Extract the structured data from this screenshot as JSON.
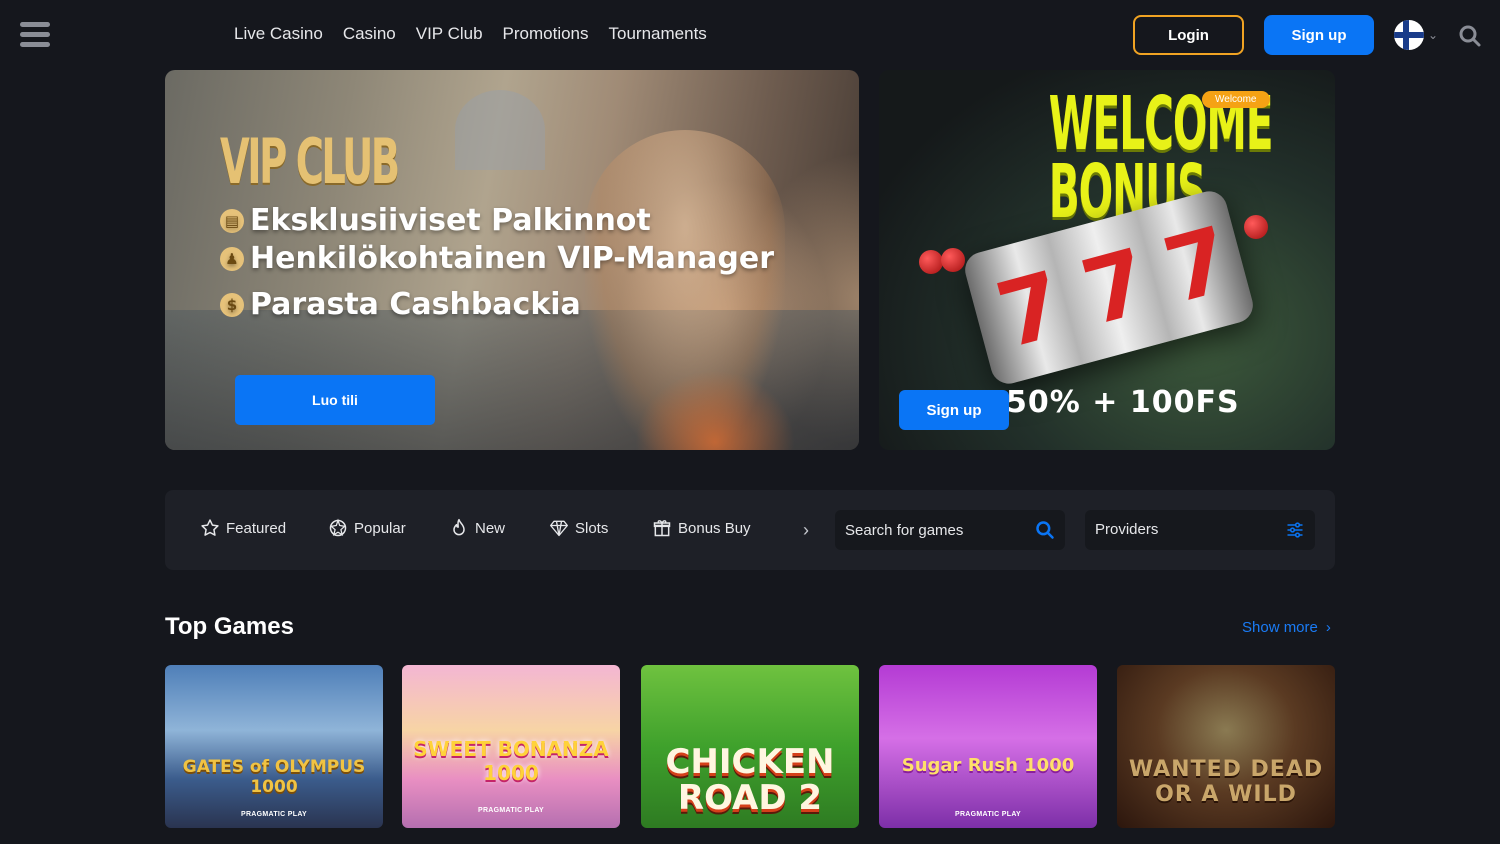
{
  "header": {
    "nav": [
      "Live Casino",
      "Casino",
      "VIP Club",
      "Promotions",
      "Tournaments"
    ],
    "login_label": "Login",
    "signup_label": "Sign up",
    "language": "fi"
  },
  "banners": {
    "vip": {
      "title": "VIP CLUB",
      "lines": [
        "Eksklusiiviset Palkinnot",
        "Henkilökohtainen VIP-Manager",
        "Parasta Cashbackia"
      ],
      "button_label": "Luo tili"
    },
    "welcome": {
      "title_line1": "WELCOME",
      "title_line2": "BONUS",
      "badge": "Welcome",
      "offer": "50% + 100FS",
      "button_label": "Sign up"
    }
  },
  "filters": {
    "categories": [
      {
        "label": "Featured",
        "icon": "star-icon"
      },
      {
        "label": "Popular",
        "icon": "popular-icon"
      },
      {
        "label": "New",
        "icon": "flame-icon"
      },
      {
        "label": "Slots",
        "icon": "diamond-icon"
      },
      {
        "label": "Bonus Buy",
        "icon": "gift-icon"
      }
    ],
    "search_placeholder": "Search for games",
    "providers_label": "Providers"
  },
  "top_games": {
    "title": "Top Games",
    "show_more": "Show more",
    "games": [
      {
        "title": "GATES of OLYMPUS 1000",
        "provider": "PRAGMATIC PLAY"
      },
      {
        "title": "SWEET BONANZA 1000",
        "provider": "PRAGMATIC PLAY"
      },
      {
        "title": "CHICKEN ROAD 2",
        "provider": ""
      },
      {
        "title": "Sugar Rush 1000",
        "provider": "PRAGMATIC PLAY"
      },
      {
        "title": "WANTED DEAD OR A WILD",
        "provider": ""
      }
    ]
  },
  "colors": {
    "background": "#15171d",
    "panel": "#1e2027",
    "accent_blue": "#0a75f5",
    "login_border": "#f0a323",
    "link_blue": "#1a7bf5"
  }
}
